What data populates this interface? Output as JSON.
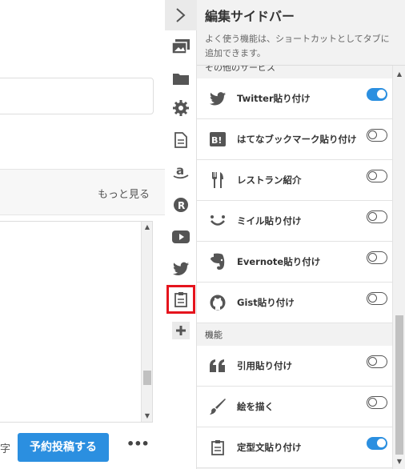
{
  "editor": {
    "more_link": "もっと見る",
    "char_suffix": "字",
    "schedule_button": "予約投稿する",
    "more_button": "•••"
  },
  "rail": {
    "icons": [
      "chevron-right-icon",
      "image-icon",
      "folder-icon",
      "gear-icon",
      "document-icon",
      "amazon-icon",
      "r-icon",
      "youtube-icon",
      "twitter-icon",
      "clipboard-icon",
      "plus-icon"
    ],
    "active_icon": "clipboard-icon",
    "active_outline_color": "#e5141d"
  },
  "panel": {
    "title": "編集サイドバー",
    "description": "よく使う機能は、ショートカットとしてタブに追加できます。",
    "sections": [
      {
        "title": "その他のサービス",
        "items": [
          {
            "label": "Twitter貼り付け",
            "icon": "twitter-icon",
            "enabled": true
          },
          {
            "label": "はてなブックマーク貼り付け",
            "icon": "hatena-bookmark-icon",
            "enabled": false
          },
          {
            "label": "レストラン紹介",
            "icon": "fork-knife-icon",
            "enabled": false
          },
          {
            "label": "ミイル貼り付け",
            "icon": "smile-icon",
            "enabled": false
          },
          {
            "label": "Evernote貼り付け",
            "icon": "evernote-icon",
            "enabled": false
          },
          {
            "label": "Gist貼り付け",
            "icon": "github-icon",
            "enabled": false
          }
        ]
      },
      {
        "title": "機能",
        "items": [
          {
            "label": "引用貼り付け",
            "icon": "quote-icon",
            "enabled": false
          },
          {
            "label": "絵を描く",
            "icon": "brush-icon",
            "enabled": false
          },
          {
            "label": "定型文貼り付け",
            "icon": "clipboard-icon",
            "enabled": true
          }
        ]
      }
    ]
  },
  "colors": {
    "accent": "#2b8fe0",
    "highlight": "#e5141d"
  }
}
